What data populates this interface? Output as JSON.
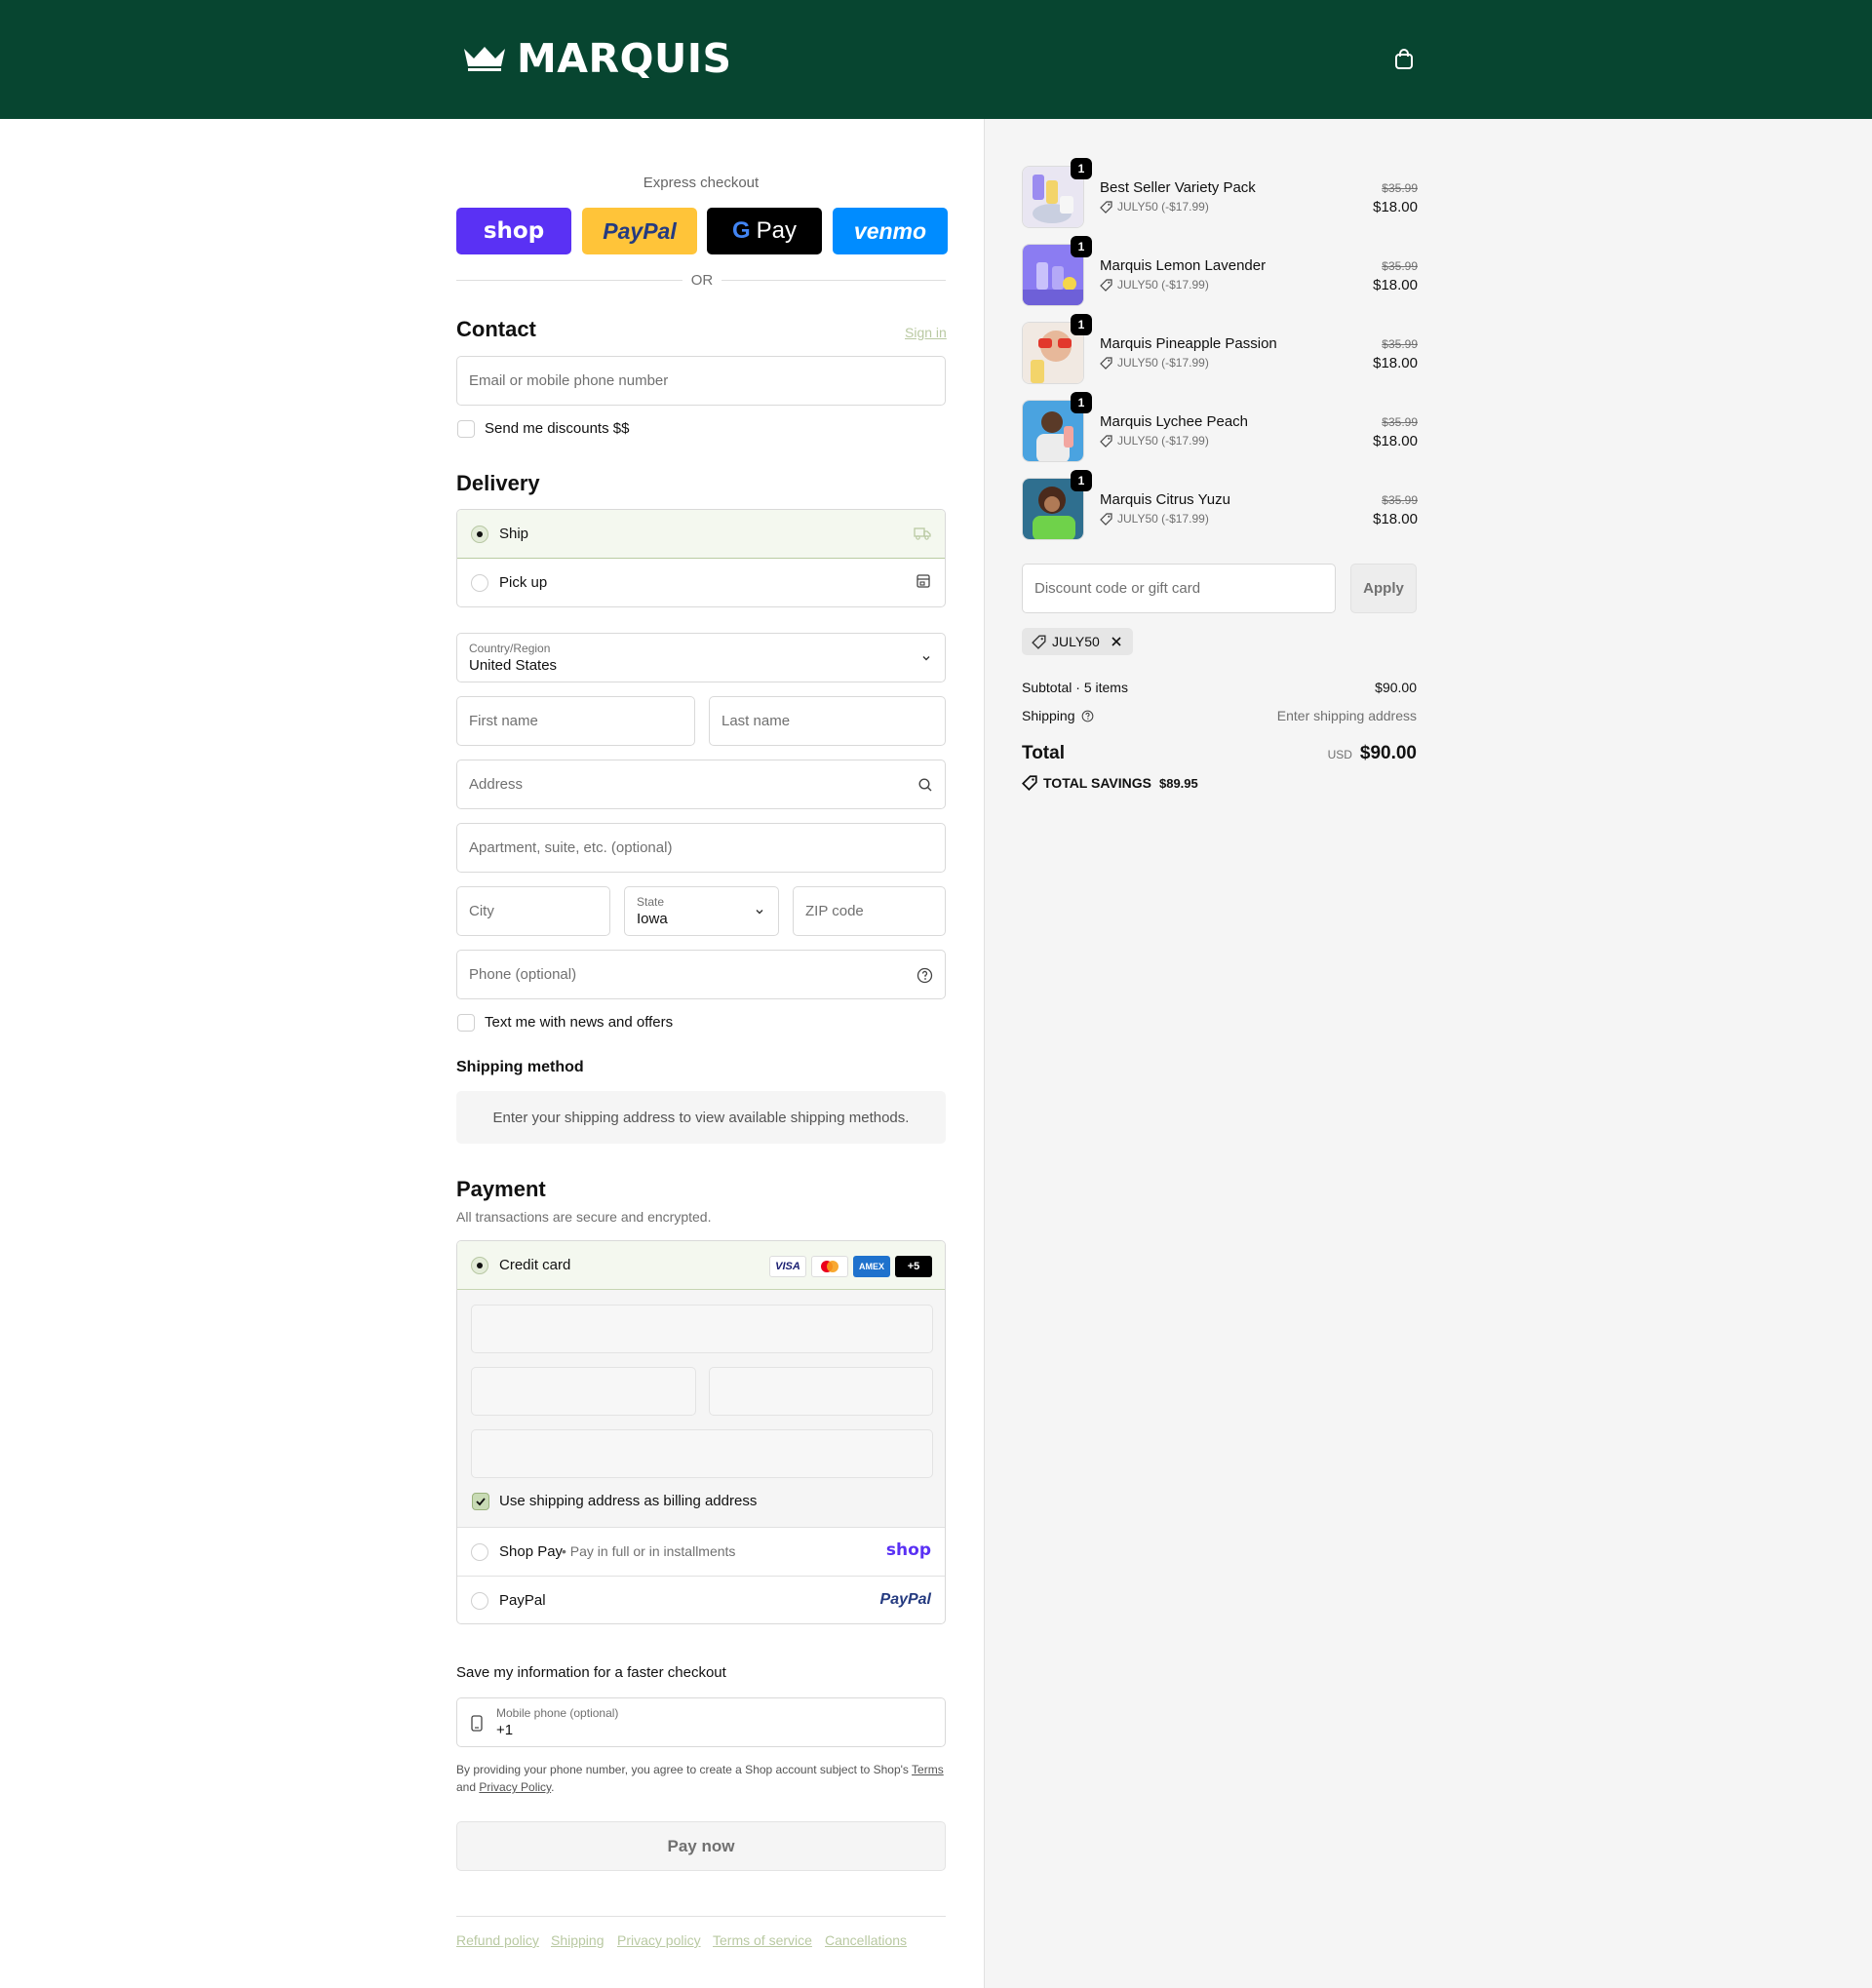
{
  "brand": {
    "name": "MARQUIS",
    "header_bg": "#074530",
    "accent": "#b9c9a2"
  },
  "header": {
    "cart_icon": "shopping-bag-icon"
  },
  "express": {
    "label": "Express checkout",
    "buttons": [
      "shop",
      "PayPal",
      "Pay",
      "venmo"
    ],
    "or_text": "OR"
  },
  "contact": {
    "title": "Contact",
    "sign_in": "Sign in",
    "email_placeholder": "Email or mobile phone number",
    "discounts_label": "Send me discounts $$"
  },
  "delivery": {
    "title": "Delivery",
    "options": [
      {
        "label": "Ship",
        "selected": true,
        "icon": "truck-icon"
      },
      {
        "label": "Pick up",
        "selected": false,
        "icon": "store-icon"
      }
    ],
    "country": {
      "label": "Country/Region",
      "value": "United States"
    },
    "first_name": "First name",
    "last_name": "Last name",
    "address": "Address",
    "apartment": "Apartment, suite, etc. (optional)",
    "city": "City",
    "state": {
      "label": "State",
      "value": "Iowa"
    },
    "zip": "ZIP code",
    "phone": "Phone (optional)",
    "text_offers": "Text me with news and offers"
  },
  "shipping_method": {
    "title": "Shipping method",
    "message": "Enter your shipping address to view available shipping methods."
  },
  "payment": {
    "title": "Payment",
    "subtitle": "All transactions are secure and encrypted.",
    "credit_card": "Credit card",
    "card_brands": [
      "VISA",
      "Mastercard",
      "AMEX",
      "+5"
    ],
    "billing_same": "Use shipping address as billing address",
    "shop_pay": "Shop Pay",
    "shop_pay_note": "Pay in full or in installments",
    "shop_pay_logo": "shop",
    "paypal": "PayPal",
    "paypal_logo": "PayPal"
  },
  "save_info": {
    "title": "Save my information for a faster checkout",
    "mobile_label": "Mobile phone (optional)",
    "mobile_value": "+1",
    "legal_prefix": "By providing your phone number, you agree to create a Shop account subject to Shop's",
    "terms": "Terms",
    "and": "and",
    "privacy": "Privacy Policy"
  },
  "pay_now": "Pay now",
  "footer_links": [
    "Refund policy",
    "Shipping",
    "Privacy policy",
    "Terms of service",
    "Cancellations"
  ],
  "cart": {
    "items": [
      {
        "name": "Best Seller Variety Pack",
        "qty": "1",
        "discount": "JULY50 (-$17.99)",
        "old_price": "$35.99",
        "price": "$18.00"
      },
      {
        "name": "Marquis Lemon Lavender",
        "qty": "1",
        "discount": "JULY50 (-$17.99)",
        "old_price": "$35.99",
        "price": "$18.00"
      },
      {
        "name": "Marquis Pineapple Passion",
        "qty": "1",
        "discount": "JULY50 (-$17.99)",
        "old_price": "$35.99",
        "price": "$18.00"
      },
      {
        "name": "Marquis Lychee Peach",
        "qty": "1",
        "discount": "JULY50 (-$17.99)",
        "old_price": "$35.99",
        "price": "$18.00"
      },
      {
        "name": "Marquis Citrus Yuzu",
        "qty": "1",
        "discount": "JULY50 (-$17.99)",
        "old_price": "$35.99",
        "price": "$18.00"
      }
    ],
    "discount_placeholder": "Discount code or gift card",
    "apply": "Apply",
    "applied_code": "JULY50",
    "subtotal_label": "Subtotal · 5 items",
    "subtotal": "$90.00",
    "shipping_label": "Shipping",
    "shipping_value": "Enter shipping address",
    "total_label": "Total",
    "currency": "USD",
    "total": "$90.00",
    "savings_label": "TOTAL SAVINGS",
    "savings": "$89.95"
  }
}
